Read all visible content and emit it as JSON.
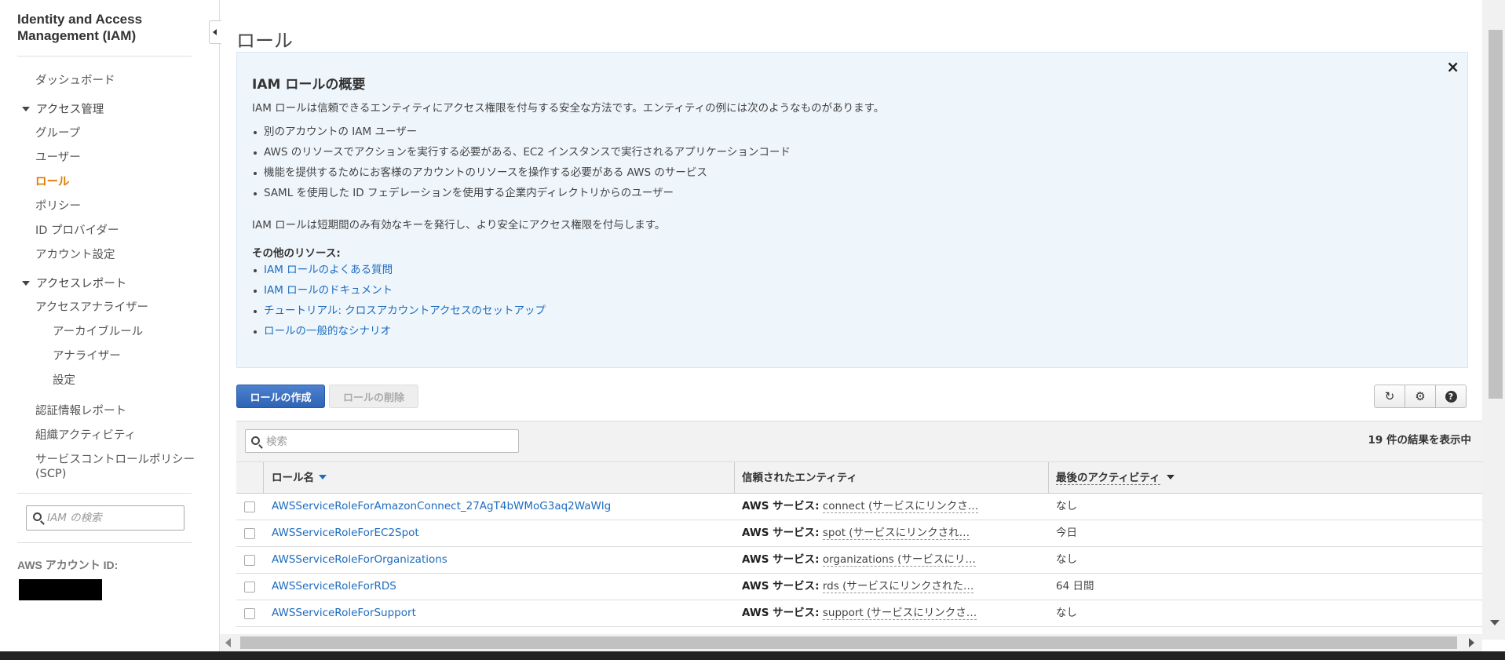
{
  "sidebar": {
    "title": "Identity and Access Management (IAM)",
    "dashboard": "ダッシュボード",
    "access_mgmt": {
      "label": "アクセス管理",
      "items": [
        "グループ",
        "ユーザー",
        "ロール",
        "ポリシー",
        "ID プロバイダー",
        "アカウント設定"
      ],
      "active": "ロール"
    },
    "access_reports": {
      "label": "アクセスレポート",
      "analyzer": "アクセスアナライザー",
      "analyzer_sub": [
        "アーカイブルール",
        "アナライザー",
        "設定"
      ],
      "others": [
        "認証情報レポート",
        "組織アクティビティ"
      ],
      "scp_line1": "サービスコントロールポリシー",
      "scp_line2": "(SCP)"
    },
    "search_placeholder": "IAM の検索",
    "account_id_label": "AWS アカウント ID:"
  },
  "page": {
    "title": "ロール"
  },
  "info": {
    "heading": "IAM ロールの概要",
    "intro": "IAM ロールは信頼できるエンティティにアクセス権限を付与する安全な方法です。エンティティの例には次のようなものがあります。",
    "examples": [
      "別のアカウントの IAM ユーザー",
      "AWS のリソースでアクションを実行する必要がある、EC2 インスタンスで実行されるアプリケーションコード",
      "機能を提供するためにお客様のアカウントのリソースを操作する必要がある AWS のサービス",
      "SAML を使用した ID フェデレーションを使用する企業内ディレクトリからのユーザー"
    ],
    "note": "IAM ロールは短期間のみ有効なキーを発行し、より安全にアクセス権限を付与します。",
    "other_resources_label": "その他のリソース:",
    "links": [
      "IAM ロールのよくある質問",
      "IAM ロールのドキュメント",
      "チュートリアル: クロスアカウントアクセスのセットアップ",
      "ロールの一般的なシナリオ"
    ],
    "close_glyph": "×"
  },
  "toolbar": {
    "create": "ロールの作成",
    "delete": "ロールの削除",
    "refresh_icon": "↻",
    "settings_icon": "⚙",
    "help_icon": "?"
  },
  "table": {
    "search_placeholder": "検索",
    "result_count": "19 件の結果を表示中",
    "columns": [
      "ロール名",
      "信頼されたエンティティ",
      "最後のアクティビティ"
    ],
    "rows": [
      {
        "name": "AWSServiceRoleForAmazonConnect_27AgT4bWMoG3aq2WaWlg",
        "entity_prefix": "AWS サービス:",
        "entity_value": "connect (サービスにリンクさ…",
        "activity": "なし"
      },
      {
        "name": "AWSServiceRoleForEC2Spot",
        "entity_prefix": "AWS サービス:",
        "entity_value": "spot (サービスにリンクされ…",
        "activity": "今日"
      },
      {
        "name": "AWSServiceRoleForOrganizations",
        "entity_prefix": "AWS サービス:",
        "entity_value": "organizations (サービスにリ…",
        "activity": "なし"
      },
      {
        "name": "AWSServiceRoleForRDS",
        "entity_prefix": "AWS サービス:",
        "entity_value": "rds (サービスにリンクされた…",
        "activity": "64 日間"
      },
      {
        "name": "AWSServiceRoleForSupport",
        "entity_prefix": "AWS サービス:",
        "entity_value": "support (サービスにリンクさ…",
        "activity": "なし"
      }
    ]
  }
}
